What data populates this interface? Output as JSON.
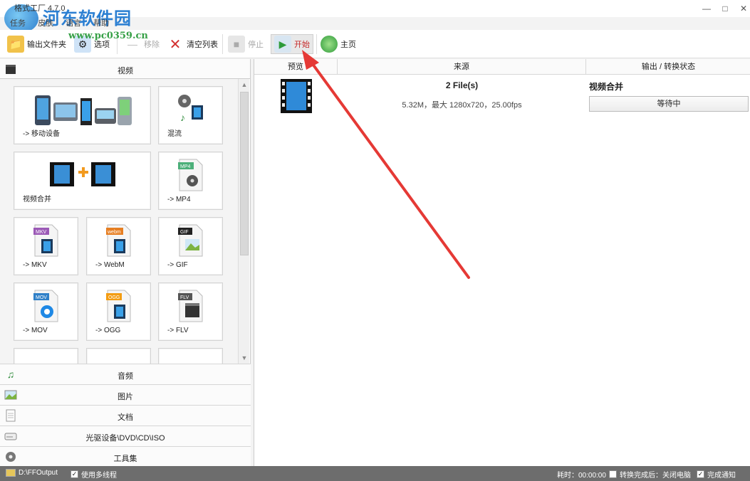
{
  "window": {
    "title": "格式工厂 4.7.0",
    "controls": [
      "—",
      "□",
      "✕"
    ]
  },
  "watermark": {
    "text": "河东软件园",
    "url": "www.pc0359.cn"
  },
  "menu": [
    "任务",
    "皮肤",
    "语言",
    "帮助"
  ],
  "toolbar": {
    "output_folder": "输出文件夹",
    "options": "选项",
    "remove": "移除",
    "clear_list": "清空列表",
    "stop": "停止",
    "start": "开始",
    "home": "主页"
  },
  "left": {
    "video_header": "视频",
    "tiles": [
      {
        "label": "-> 移动设备"
      },
      {
        "label": "混流"
      },
      {
        "label": "视频合并"
      },
      {
        "label": "-> MP4",
        "badge": "MP4"
      },
      {
        "label": "-> MKV",
        "badge": "MKV"
      },
      {
        "label": "-> WebM",
        "badge": "webm"
      },
      {
        "label": "-> GIF",
        "badge": "GIF"
      },
      {
        "label": "-> MOV",
        "badge": "MOV"
      },
      {
        "label": "-> OGG",
        "badge": "OGG"
      },
      {
        "label": "-> FLV",
        "badge": "FLV"
      }
    ],
    "categories": [
      {
        "label": "音频",
        "icon": "music-note-icon"
      },
      {
        "label": "图片",
        "icon": "picture-icon"
      },
      {
        "label": "文档",
        "icon": "document-icon"
      },
      {
        "label": "光驱设备\\DVD\\CD\\ISO",
        "icon": "disc-drive-icon"
      },
      {
        "label": "工具集",
        "icon": "toolbox-icon"
      }
    ]
  },
  "right": {
    "columns": [
      "预览",
      "来源",
      "输出 / 转换状态"
    ],
    "task": {
      "source_count": "2 File(s)",
      "source_meta": "5.32M，最大 1280x720，25.00fps",
      "output_name": "视频合并",
      "status": "等待中"
    }
  },
  "statusbar": {
    "output_path": "D:\\FFOutput",
    "multithread": "使用多线程",
    "elapsed": "耗时：00:00:00",
    "after_convert": "转换完成后：关闭电脑",
    "notify": "完成通知"
  },
  "colors": {
    "annotation_arrow": "#e53935",
    "status_bar": "#6d6d6d",
    "watermark_blue": "#2b7fd2",
    "watermark_green": "#36a046"
  }
}
